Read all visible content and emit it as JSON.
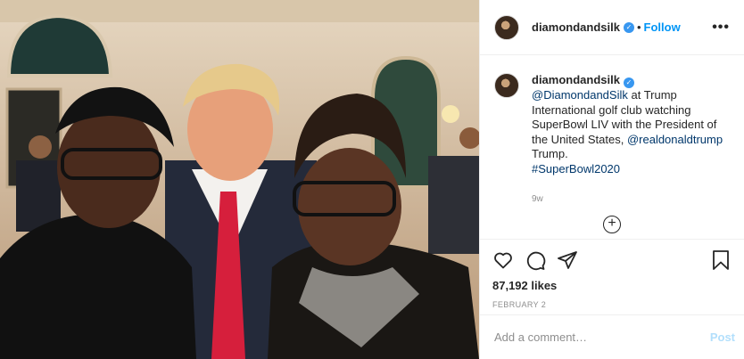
{
  "post": {
    "username": "diamondandsilk",
    "verified_icon": "verified-badge-icon",
    "separator": "•",
    "follow_label": "Follow",
    "more_label": "•••",
    "caption": {
      "username": "diamondandsilk",
      "mention_1": "@DiamondandSilk",
      "text_1": " at Trump International golf club watching SuperBowl LIV with the President of the United States, ",
      "mention_2": "@realdonaldtrump",
      "text_2": " Trump.",
      "hashtag": "#SuperBowl2020"
    },
    "time_ago": "9w",
    "load_more_icon": "plus-circle-icon",
    "actions": {
      "like_icon": "heart-icon",
      "comment_icon": "comment-icon",
      "share_icon": "share-icon",
      "save_icon": "bookmark-icon"
    },
    "likes": "87,192 likes",
    "date": "FEBRUARY 2",
    "comment_placeholder": "Add a comment…",
    "post_label": "Post"
  },
  "colors": {
    "accent": "#0095f6",
    "verified": "#3897f0",
    "post_disabled": "#b2dffc",
    "muted": "#8e8e8e",
    "link": "#00376b"
  }
}
